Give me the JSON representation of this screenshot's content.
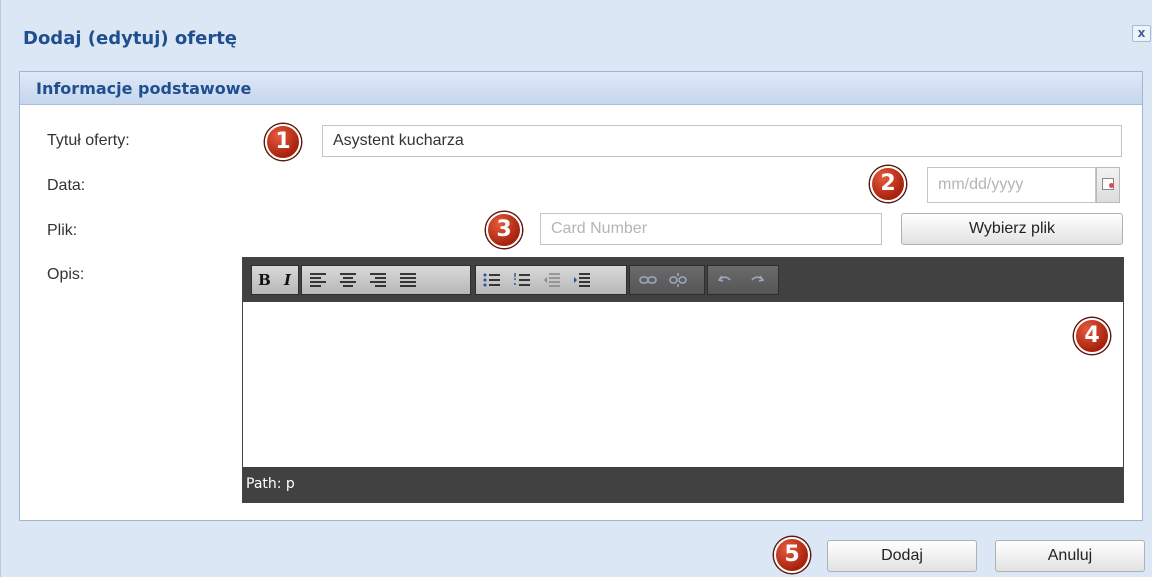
{
  "dialog": {
    "title": "Dodaj (edytuj) ofertę",
    "close_label": "x"
  },
  "section": {
    "title": "Informacje podstawowe"
  },
  "form": {
    "title_label": "Tytuł oferty:",
    "title_value": "Asystent kucharza",
    "date_label": "Data:",
    "date_placeholder": "mm/dd/yyyy",
    "file_label": "Plik:",
    "file_placeholder": "Card Number",
    "file_button": "Wybierz plik",
    "description_label": "Opis:"
  },
  "editor": {
    "toolbar_buttons": [
      "bold-icon",
      "italic-icon",
      "align-left-icon",
      "align-center-icon",
      "align-right-icon",
      "align-justify-icon",
      "bulleted-list-icon",
      "numbered-list-icon",
      "outdent-icon",
      "indent-icon",
      "link-icon",
      "unlink-icon",
      "undo-icon",
      "redo-icon"
    ],
    "bold_label": "B",
    "italic_label": "I",
    "path_text": "Path: p"
  },
  "footer": {
    "add_button": "Dodaj",
    "cancel_button": "Anuluj"
  },
  "badges": [
    "1",
    "2",
    "3",
    "4",
    "5"
  ],
  "colors": {
    "dialog_title": "#1f4f8f",
    "dialog_background": "#dce7f5",
    "badge": "#c0321a",
    "editor_bar": "#414141"
  }
}
